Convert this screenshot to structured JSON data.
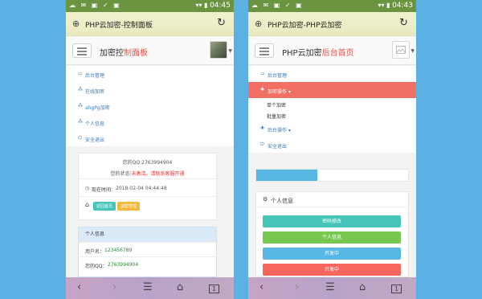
{
  "left": {
    "status": {
      "icons": "☁ ✉ ▣ ✓ ▣",
      "signal": "▾▾ ▮",
      "time": "04:45"
    },
    "title": "PHP云加密-控制面板",
    "brand_prefix": "加密控",
    "brand_accent": "制面板",
    "menu": [
      "后台管理",
      "在线加密",
      "ahgPg加密",
      "个人信息",
      "安全退出"
    ],
    "menu_icons": [
      "▭",
      "⁂",
      "⁂",
      "⁂",
      "⏻"
    ],
    "account": {
      "qq_line": "您的QQ:2763994904",
      "state_label": "您的状态:",
      "state_value": "未激活，请联系客服开通",
      "time_label": "现在时间:",
      "time_value": "2018-02-04 04:44:48",
      "home_icon": "home-icon",
      "chip_home": "返回首页",
      "chip_admin": "加密管理"
    },
    "personal": {
      "header": "个人信息",
      "username_label": "用户名：",
      "username_value": "123456789",
      "qq_label": "您的QQ：",
      "qq_value": "2763994904"
    }
  },
  "right": {
    "status": {
      "icons": "☁ ✉ ▣ ✓ ▣",
      "signal": "▾▾ ▮",
      "time": "04:43"
    },
    "title": "PHP云加密-PHP云加密",
    "brand_prefix": "PHP云加密",
    "brand_accent": "后台首页",
    "menu_top": "后台管理",
    "menu_active": "加密操作",
    "sub_items": [
      "单个加密",
      "批量加密"
    ],
    "menu_bottom": [
      "后台操作",
      "安全退出"
    ],
    "info_header": "个人信息",
    "buttons": [
      "密码修改",
      "个人信息",
      "开发中",
      "开发中"
    ]
  },
  "nav": {
    "back": "‹",
    "forward": "›",
    "menu": "☰",
    "home": "⌂",
    "tabs": "1"
  },
  "colors": {
    "teal": "#47c4b8",
    "green": "#78c850",
    "blue": "#59b7e6",
    "red": "#f6665d",
    "yellow": "#f4b93a"
  }
}
